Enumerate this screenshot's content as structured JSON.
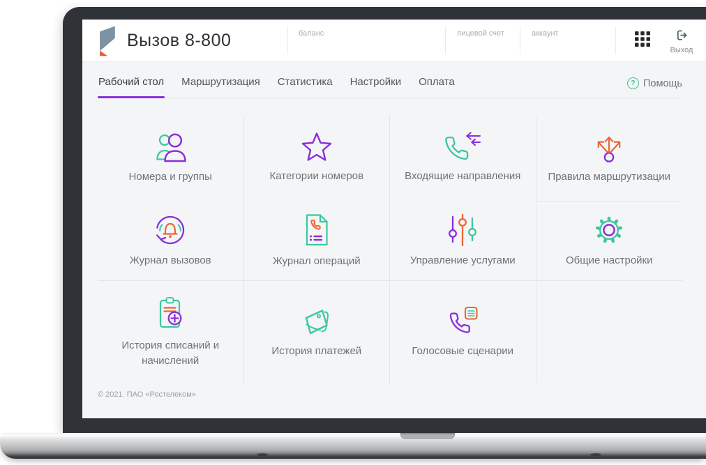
{
  "app": {
    "title": "Вызов 8-800",
    "logout_label": "Выход"
  },
  "header": {
    "fields": [
      {
        "label": "баланс"
      },
      {
        "label": "лицевой счет"
      },
      {
        "label": "аккаунт"
      }
    ]
  },
  "nav": {
    "tabs": [
      {
        "label": "Рабочий стол",
        "active": true
      },
      {
        "label": "Маршрутизация",
        "active": false
      },
      {
        "label": "Статистика",
        "active": false
      },
      {
        "label": "Настройки",
        "active": false
      },
      {
        "label": "Оплата",
        "active": false
      }
    ],
    "help_icon": "?",
    "help_label": "Помощь"
  },
  "tiles": [
    {
      "label": "Номера и группы",
      "icon": "people-icon"
    },
    {
      "label": "Категории номеров",
      "icon": "star-icon"
    },
    {
      "label": "Входящие направления",
      "icon": "incoming-call-icon"
    },
    {
      "label": "Правила маршрутизации",
      "icon": "route-split-icon"
    },
    {
      "label": "Журнал вызовов",
      "icon": "call-log-icon"
    },
    {
      "label": "Журнал операций",
      "icon": "operations-log-icon"
    },
    {
      "label": "Управление услугами",
      "icon": "sliders-icon"
    },
    {
      "label": "Общие настройки",
      "icon": "gear-icon"
    },
    {
      "label": "История списаний и начислений",
      "icon": "charges-history-icon"
    },
    {
      "label": "История платежей",
      "icon": "payments-history-icon"
    },
    {
      "label": "Голосовые сценарии",
      "icon": "voice-scenario-icon"
    }
  ],
  "footer": {
    "copyright": "© 2021. ПАО «Ростелеком»"
  },
  "colors": {
    "accent_purple": "#8a2edb",
    "accent_teal": "#3dc89e",
    "accent_orange": "#ee6436",
    "logo_gray": "#7d93a3",
    "logo_orange": "#f0562e",
    "page_bg": "#f4f5f6"
  }
}
